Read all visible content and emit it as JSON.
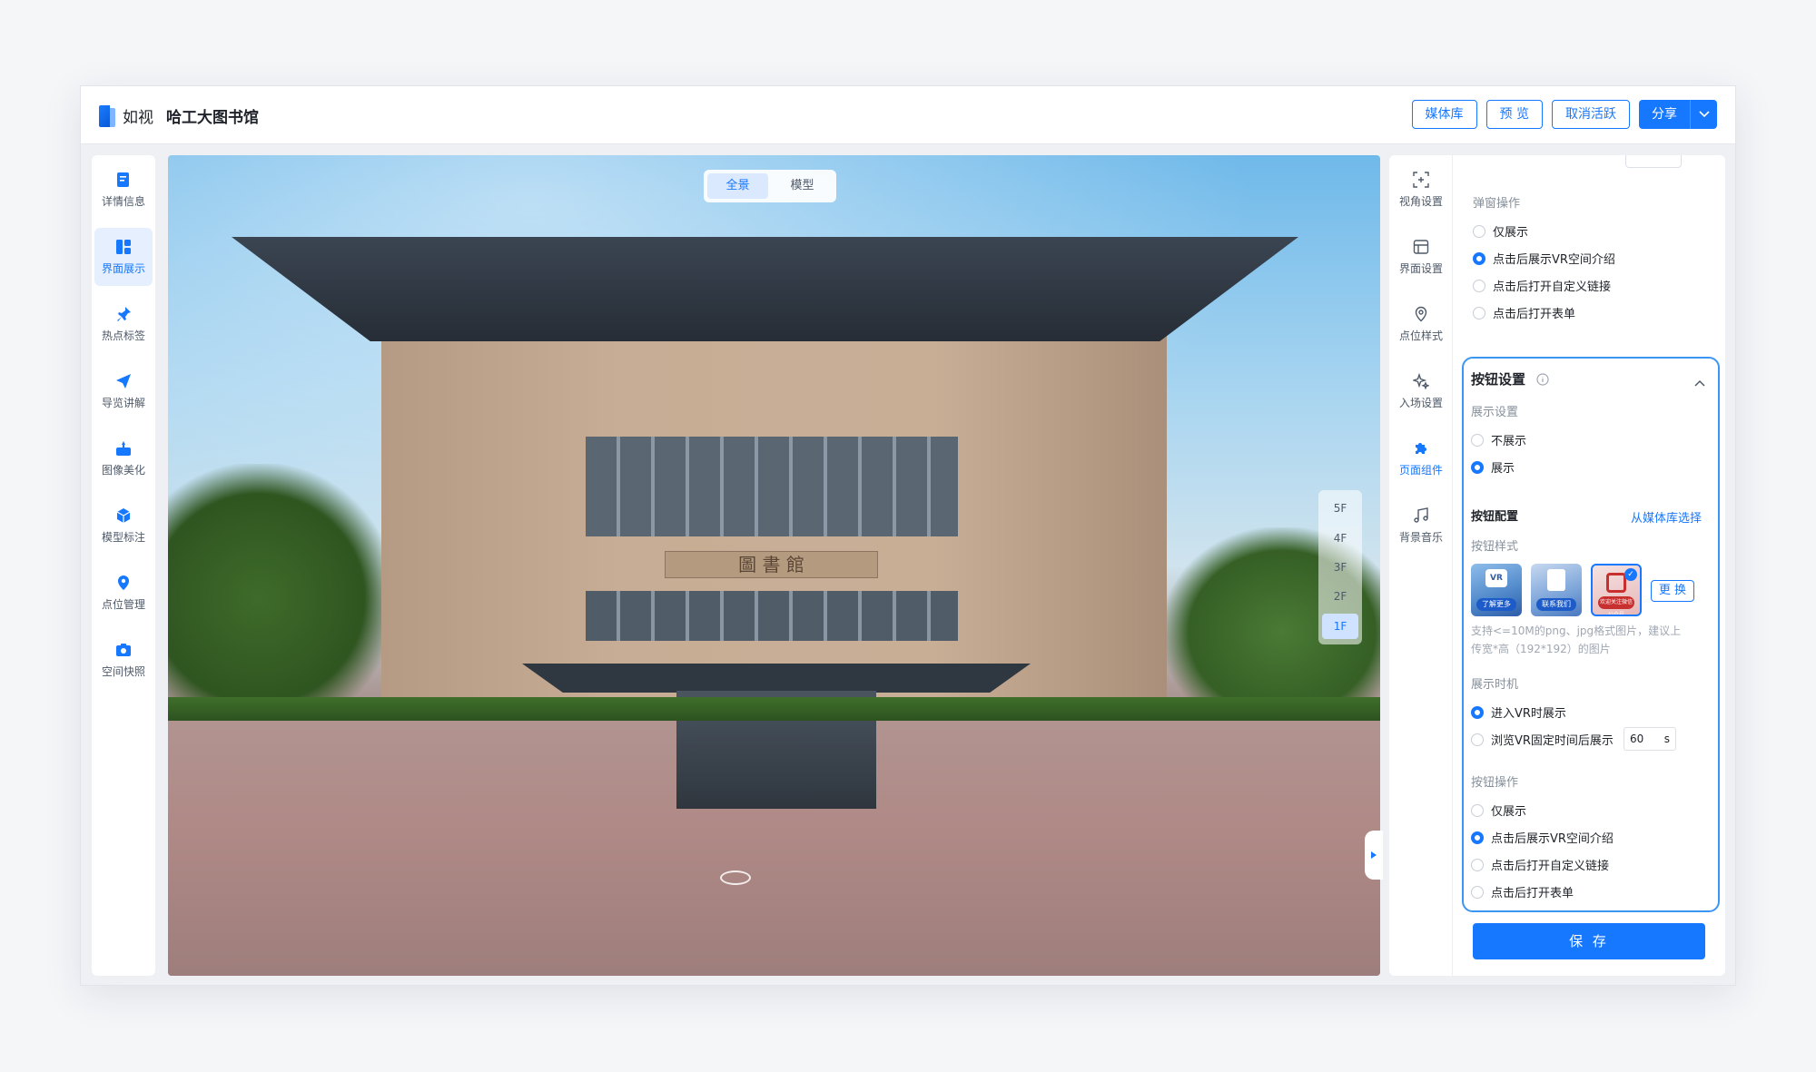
{
  "header": {
    "logo_text": "如视",
    "title": "哈工大图书馆",
    "buttons": [
      "媒体库",
      "预 览",
      "取消活跃"
    ],
    "share_label": "分享"
  },
  "left_sidebar": {
    "items": [
      {
        "label": "详情信息",
        "icon": "doc-icon"
      },
      {
        "label": "界面展示",
        "icon": "layout-icon",
        "active": true
      },
      {
        "label": "热点标签",
        "icon": "pin-icon"
      },
      {
        "label": "导览讲解",
        "icon": "send-icon"
      },
      {
        "label": "图像美化",
        "icon": "image-enhance-icon"
      },
      {
        "label": "模型标注",
        "icon": "cube-icon"
      },
      {
        "label": "点位管理",
        "icon": "location-icon"
      },
      {
        "label": "空间快照",
        "icon": "camera-icon"
      }
    ]
  },
  "viewport": {
    "modes": [
      "全景",
      "模型"
    ],
    "active_mode": "全景",
    "floors": [
      "5F",
      "4F",
      "3F",
      "2F",
      "1F"
    ],
    "active_floor": "1F",
    "sign_text": "圖  書  館"
  },
  "right_bar": {
    "items": [
      {
        "label": "视角设置",
        "icon": "viewangle-icon"
      },
      {
        "label": "界面设置",
        "icon": "screen-icon"
      },
      {
        "label": "点位样式",
        "icon": "location-outline-icon"
      },
      {
        "label": "入场设置",
        "icon": "sparkle-icon"
      },
      {
        "label": "页面组件",
        "icon": "puzzle-icon",
        "active": true
      },
      {
        "label": "背景音乐",
        "icon": "music-icon"
      }
    ]
  },
  "panel": {
    "popup_op_title": "弹窗操作",
    "popup_ops": [
      "仅展示",
      "点击后展示VR空间介绍",
      "点击后打开自定义链接",
      "点击后打开表单"
    ],
    "popup_selected": 1,
    "button_settings": {
      "title": "按钮设置",
      "display_title": "展示设置",
      "display_options": [
        "不展示",
        "展示"
      ],
      "display_selected": 1,
      "config_title": "按钮配置",
      "config_link": "从媒体库选择",
      "style_title": "按钮样式",
      "thumb_captions": [
        "了解更多",
        "联系我们",
        "欢迎关注微信公众号"
      ],
      "replace_label": "更 换",
      "hint_line1": "支持<=10M的png、jpg格式图片，建议上",
      "hint_line2": "传宽*高（192*192）的图片",
      "timing_title": "展示时机",
      "timing_options": [
        "进入VR时展示",
        "浏览VR固定时间后展示"
      ],
      "timing_selected": 0,
      "timing_value": "60",
      "timing_unit": "s",
      "op_title": "按钮操作",
      "ops": [
        "仅展示",
        "点击后展示VR空间介绍",
        "点击后打开自定义链接",
        "点击后打开表单"
      ],
      "op_selected": 1
    },
    "save_label": "保 存"
  },
  "colors": {
    "accent": "#1677ff",
    "active_bg": "#e6effd",
    "card_border": "#3b95f2"
  }
}
